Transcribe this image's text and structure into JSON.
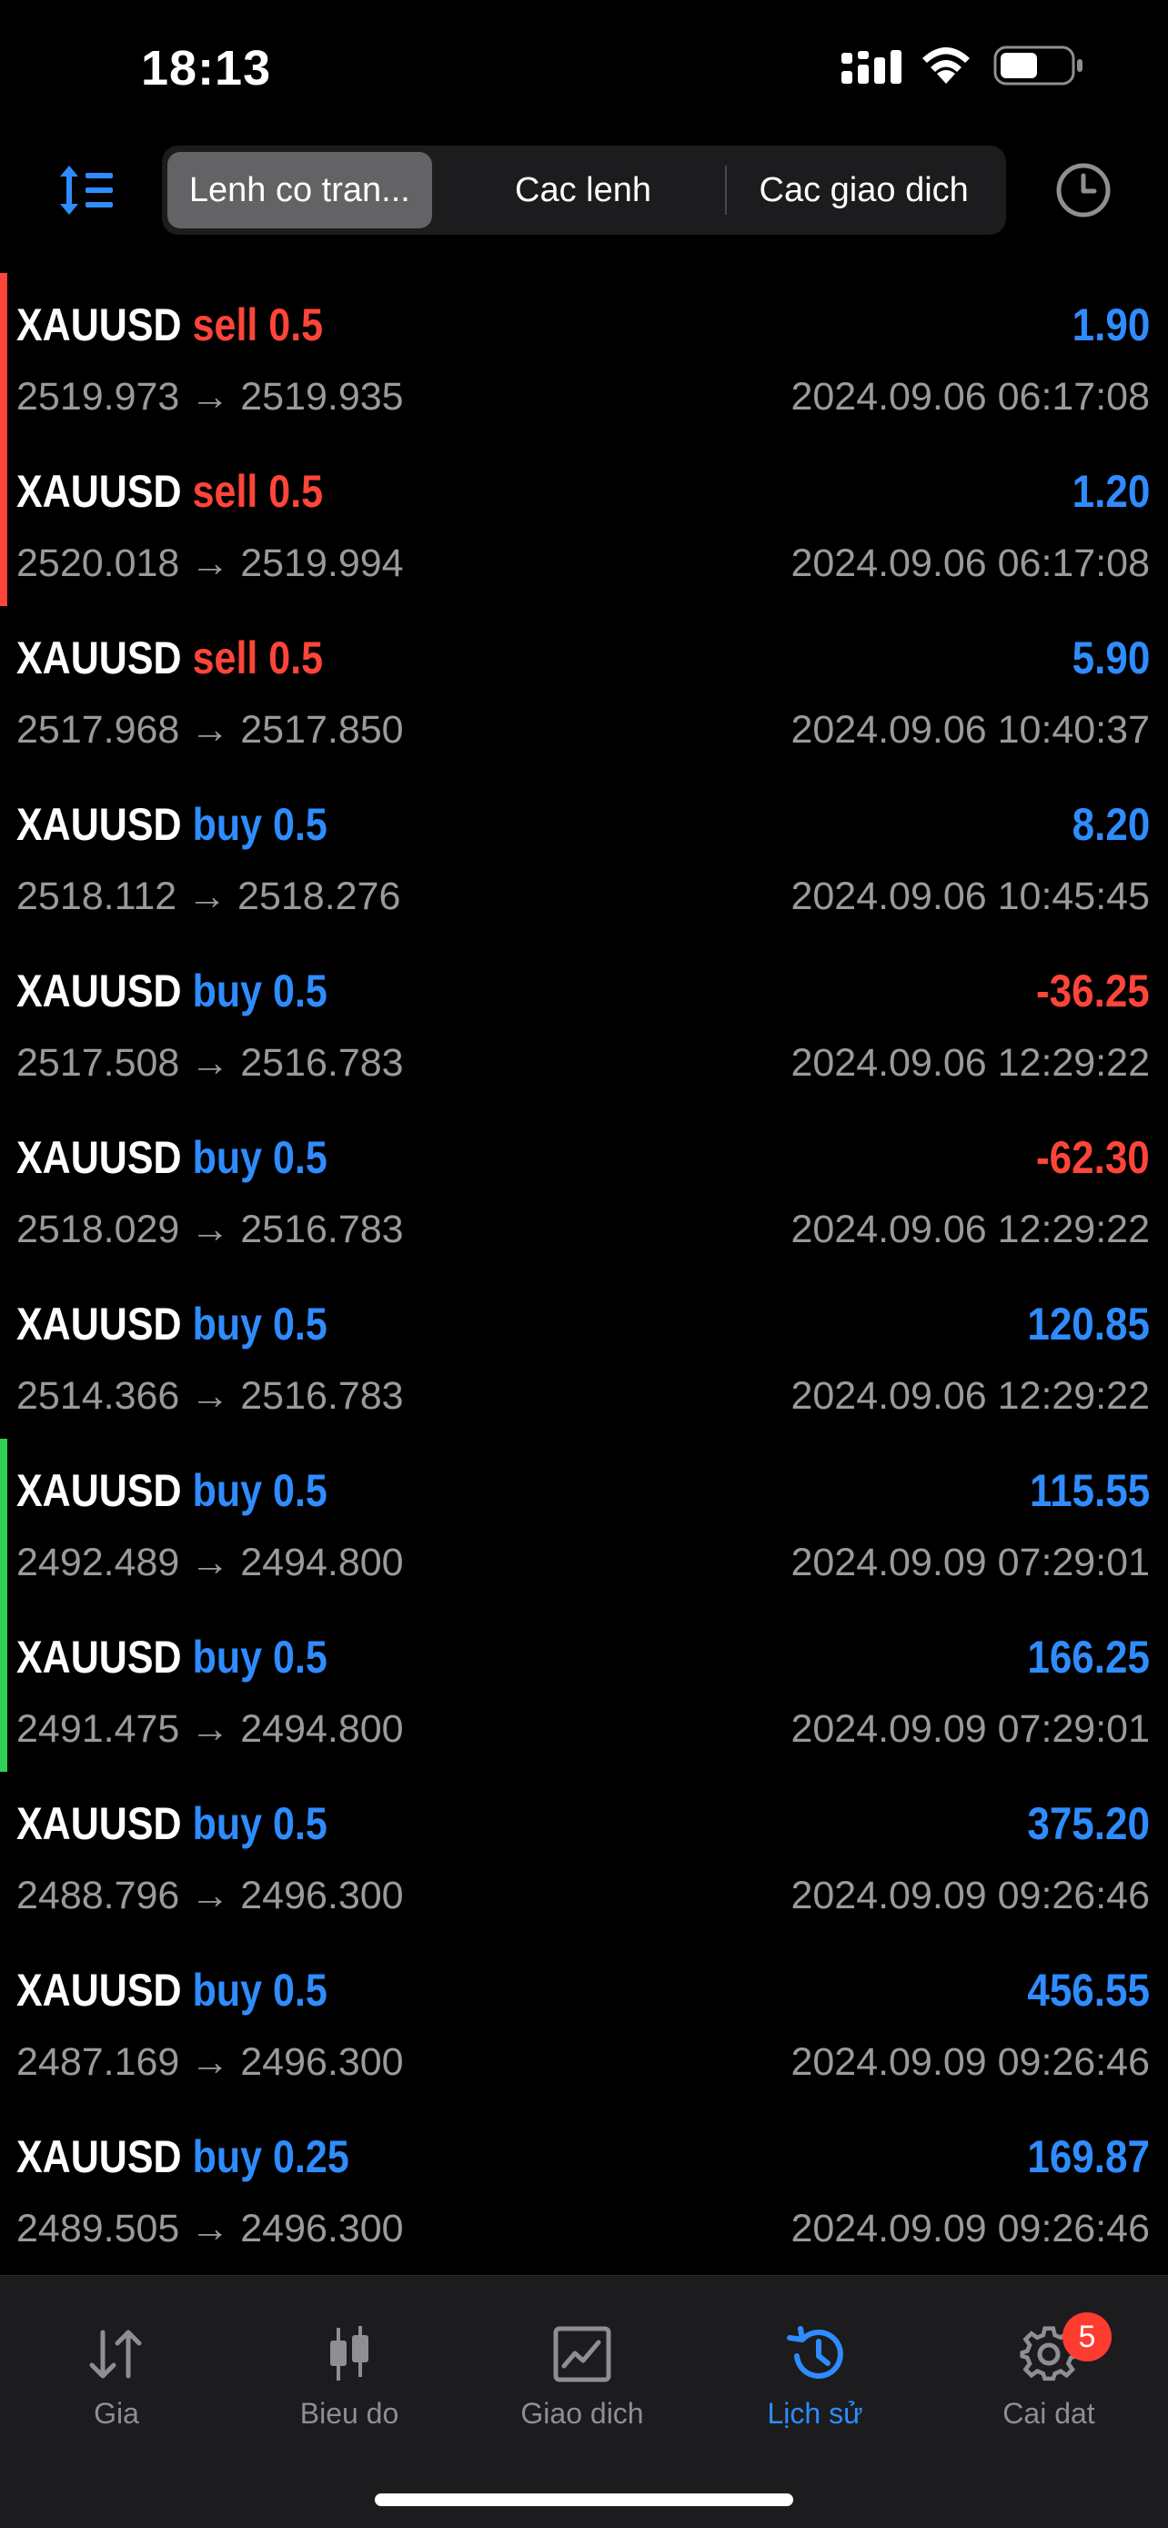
{
  "status_bar": {
    "time": "18:13"
  },
  "header": {
    "tabs": [
      {
        "label": "Lenh co tran...",
        "active": true
      },
      {
        "label": "Cac lenh",
        "active": false
      },
      {
        "label": "Cac giao dich",
        "active": false
      }
    ]
  },
  "colors": {
    "blue": "#2f8cff",
    "red": "#ff453a",
    "green": "#30d158",
    "gray": "#9a9a9e"
  },
  "deals": [
    {
      "symbol": "XAUUSD",
      "type": "sell",
      "volume": "0.5",
      "prices": "2519.973 → 2519.935",
      "profit": "1.90",
      "time": "2024.09.06 06:17:08",
      "marker": "red"
    },
    {
      "symbol": "XAUUSD",
      "type": "sell",
      "volume": "0.5",
      "prices": "2520.018 → 2519.994",
      "profit": "1.20",
      "time": "2024.09.06 06:17:08",
      "marker": "red"
    },
    {
      "symbol": "XAUUSD",
      "type": "sell",
      "volume": "0.5",
      "prices": "2517.968 → 2517.850",
      "profit": "5.90",
      "time": "2024.09.06 10:40:37",
      "marker": "none"
    },
    {
      "symbol": "XAUUSD",
      "type": "buy",
      "volume": "0.5",
      "prices": "2518.112 → 2518.276",
      "profit": "8.20",
      "time": "2024.09.06 10:45:45",
      "marker": "none"
    },
    {
      "symbol": "XAUUSD",
      "type": "buy",
      "volume": "0.5",
      "prices": "2517.508 → 2516.783",
      "profit": "-36.25",
      "time": "2024.09.06 12:29:22",
      "marker": "none"
    },
    {
      "symbol": "XAUUSD",
      "type": "buy",
      "volume": "0.5",
      "prices": "2518.029 → 2516.783",
      "profit": "-62.30",
      "time": "2024.09.06 12:29:22",
      "marker": "none"
    },
    {
      "symbol": "XAUUSD",
      "type": "buy",
      "volume": "0.5",
      "prices": "2514.366 → 2516.783",
      "profit": "120.85",
      "time": "2024.09.06 12:29:22",
      "marker": "none"
    },
    {
      "symbol": "XAUUSD",
      "type": "buy",
      "volume": "0.5",
      "prices": "2492.489 → 2494.800",
      "profit": "115.55",
      "time": "2024.09.09 07:29:01",
      "marker": "green"
    },
    {
      "symbol": "XAUUSD",
      "type": "buy",
      "volume": "0.5",
      "prices": "2491.475 → 2494.800",
      "profit": "166.25",
      "time": "2024.09.09 07:29:01",
      "marker": "green"
    },
    {
      "symbol": "XAUUSD",
      "type": "buy",
      "volume": "0.5",
      "prices": "2488.796 → 2496.300",
      "profit": "375.20",
      "time": "2024.09.09 09:26:46",
      "marker": "none"
    },
    {
      "symbol": "XAUUSD",
      "type": "buy",
      "volume": "0.5",
      "prices": "2487.169 → 2496.300",
      "profit": "456.55",
      "time": "2024.09.09 09:26:46",
      "marker": "none"
    },
    {
      "symbol": "XAUUSD",
      "type": "buy",
      "volume": "0.25",
      "prices": "2489.505 → 2496.300",
      "profit": "169.87",
      "time": "2024.09.09 09:26:46",
      "marker": "none"
    }
  ],
  "tab_bar": {
    "items": [
      {
        "label": "Gia",
        "icon": "quotes-arrows-icon",
        "active": false
      },
      {
        "label": "Bieu do",
        "icon": "candlestick-chart-icon",
        "active": false
      },
      {
        "label": "Giao dich",
        "icon": "trade-chart-icon",
        "active": false
      },
      {
        "label": "Lịch sử",
        "icon": "history-clock-icon",
        "active": true
      },
      {
        "label": "Cai dat",
        "icon": "settings-gear-icon",
        "active": false,
        "badge": "5"
      }
    ]
  }
}
